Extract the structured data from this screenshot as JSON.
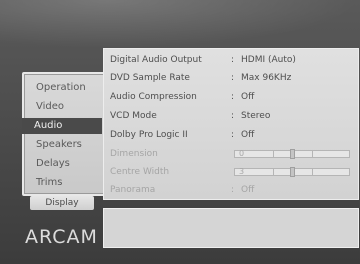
{
  "menu": {
    "items": [
      {
        "label": "Operation",
        "selected": false
      },
      {
        "label": "Video",
        "selected": false
      },
      {
        "label": "Audio",
        "selected": true
      },
      {
        "label": "Speakers",
        "selected": false
      },
      {
        "label": "Delays",
        "selected": false
      },
      {
        "label": "Trims",
        "selected": false
      }
    ],
    "display_label": "Display"
  },
  "brand": {
    "logo_text": "ARCAM"
  },
  "settings": {
    "rows": [
      {
        "label": "Digital Audio Output",
        "value": "HDMI (Auto)",
        "disabled": false
      },
      {
        "label": "DVD Sample Rate",
        "value": "Max 96KHz",
        "disabled": false
      },
      {
        "label": "Audio Compression",
        "value": "Off",
        "disabled": false
      },
      {
        "label": "VCD Mode",
        "value": "Stereo",
        "disabled": false
      },
      {
        "label": "Dolby Pro Logic II",
        "value": "Off",
        "disabled": false
      },
      {
        "label": "Dimension",
        "value": "0",
        "disabled": true,
        "control": "slider",
        "level": 0.5
      },
      {
        "label": "Centre Width",
        "value": "3",
        "disabled": true,
        "control": "slider",
        "level": 0.5
      },
      {
        "label": "Panorama",
        "value": "Off",
        "disabled": true
      }
    ],
    "separator": ":"
  },
  "colors": {
    "panel": "#d9d9d9",
    "selected_bg": "#4a4a4a",
    "text": "#4e4e4e",
    "disabled_text": "#a5a5a5"
  }
}
